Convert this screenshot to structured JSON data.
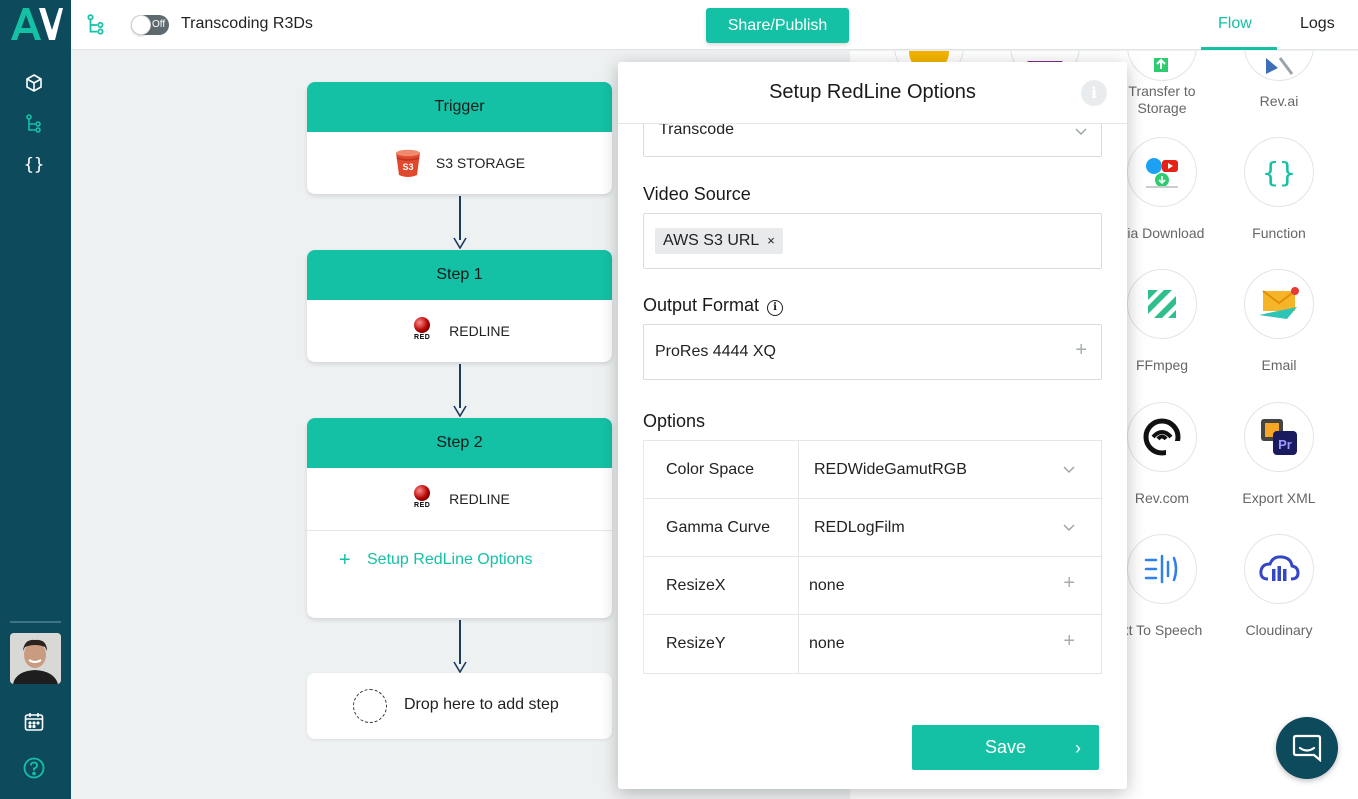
{
  "app": {
    "logo_text": "AV"
  },
  "topbar": {
    "toggle_label": "Off",
    "flow_title": "Transcoding R3Ds",
    "share_button": "Share/Publish",
    "tabs": [
      {
        "label": "Flow",
        "active": true
      },
      {
        "label": "Logs",
        "active": false
      }
    ]
  },
  "sidebar": {
    "items": [
      {
        "icon": "cube-icon"
      },
      {
        "icon": "flow-icon",
        "active": true
      },
      {
        "icon": "code-braces-icon"
      }
    ],
    "bottom": [
      {
        "icon": "calendar-icon"
      },
      {
        "icon": "help-icon"
      }
    ]
  },
  "flow": {
    "trigger": {
      "title": "Trigger",
      "service": "S3 STORAGE",
      "icon": "s3-icon"
    },
    "steps": [
      {
        "title": "Step 1",
        "service": "REDLINE",
        "icon": "red-icon"
      },
      {
        "title": "Step 2",
        "service": "REDLINE",
        "icon": "red-icon",
        "setup_label": "Setup RedLine Options"
      }
    ],
    "drop_label": "Drop here to add step"
  },
  "modal": {
    "title": "Setup RedLine Options",
    "action_value": "Transcode",
    "video_source": {
      "label": "Video Source",
      "chip": "AWS S3 URL",
      "chip_remove": "×"
    },
    "output_format": {
      "label": "Output Format",
      "value": "ProRes 4444 XQ"
    },
    "options": {
      "label": "Options",
      "rows": [
        {
          "key": "Color Space",
          "value": "REDWideGamutRGB",
          "control": "select"
        },
        {
          "key": "Gamma Curve",
          "value": "REDLogFilm",
          "control": "select"
        },
        {
          "key": "ResizeX",
          "value": "none",
          "control": "add"
        },
        {
          "key": "ResizeY",
          "value": "none",
          "control": "add"
        }
      ]
    },
    "save_button": "Save",
    "save_chevron": "›"
  },
  "integrations": [
    {
      "label": "Transfer to\nStorage"
    },
    {
      "label": "Rev.ai"
    },
    {
      "label": "dia Download"
    },
    {
      "label": "Function"
    },
    {
      "label": "FFmpeg"
    },
    {
      "label": "Email"
    },
    {
      "label": "Rev.com"
    },
    {
      "label": "Export XML"
    },
    {
      "label": "xt To Speech"
    },
    {
      "label": "Cloudinary"
    }
  ],
  "colors": {
    "accent": "#14c1a5",
    "sidebar": "#0d4a5c",
    "arrow": "#1c3c5a"
  }
}
